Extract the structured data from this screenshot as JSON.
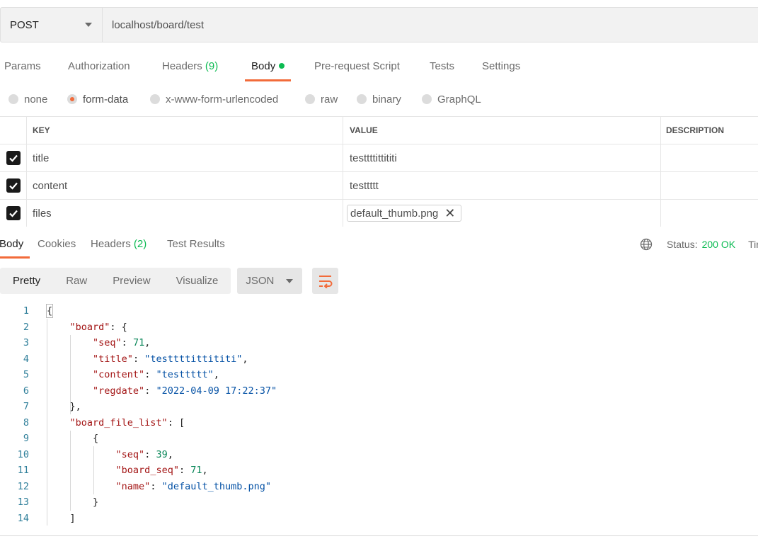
{
  "request": {
    "method": "POST",
    "url": "localhost/board/test"
  },
  "request_tabs": [
    {
      "label": "Params"
    },
    {
      "label": "Authorization"
    },
    {
      "label": "Headers",
      "count": "(9)"
    },
    {
      "label": "Body",
      "active": true
    },
    {
      "label": "Pre-request Script"
    },
    {
      "label": "Tests"
    },
    {
      "label": "Settings"
    }
  ],
  "body_types": [
    "none",
    "form-data",
    "x-www-form-urlencoded",
    "raw",
    "binary",
    "GraphQL"
  ],
  "body_type_selected": "form-data",
  "params_table": {
    "headers": [
      "KEY",
      "VALUE",
      "DESCRIPTION"
    ],
    "rows": [
      {
        "checked": true,
        "key": "title",
        "value": "testtttittititi",
        "description": ""
      },
      {
        "checked": true,
        "key": "content",
        "value": "testtttt",
        "description": ""
      },
      {
        "checked": true,
        "key": "files",
        "value": "default_thumb.png",
        "is_file": true,
        "description": ""
      }
    ]
  },
  "response_tabs": [
    {
      "label": "Body",
      "active": true
    },
    {
      "label": "Cookies"
    },
    {
      "label": "Headers",
      "count": "(2)"
    },
    {
      "label": "Test Results"
    }
  ],
  "status": {
    "label": "Status:",
    "value": "200 OK",
    "time_partial": "Tir"
  },
  "view_modes": [
    "Pretty",
    "Raw",
    "Preview",
    "Visualize"
  ],
  "view_mode_selected": "Pretty",
  "format": "JSON",
  "code_lines": [
    {
      "n": "1",
      "text": "{"
    },
    {
      "n": "2",
      "text": "    \"board\": {"
    },
    {
      "n": "3",
      "text": "        \"seq\": 71,"
    },
    {
      "n": "4",
      "text": "        \"title\": \"testtttittititi\","
    },
    {
      "n": "5",
      "text": "        \"content\": \"testtttt\","
    },
    {
      "n": "6",
      "text": "        \"regdate\": \"2022-04-09 17:22:37\""
    },
    {
      "n": "7",
      "text": "    },"
    },
    {
      "n": "8",
      "text": "    \"board_file_list\": ["
    },
    {
      "n": "9",
      "text": "        {"
    },
    {
      "n": "10",
      "text": "            \"seq\": 39,"
    },
    {
      "n": "11",
      "text": "            \"board_seq\": 71,"
    },
    {
      "n": "12",
      "text": "            \"name\": \"default_thumb.png\""
    },
    {
      "n": "13",
      "text": "        }"
    },
    {
      "n": "14",
      "text": "    ]"
    }
  ],
  "colors": {
    "accent": "#f26b3a",
    "success": "#0cbb52",
    "json_key": "#a31515",
    "json_string": "#0451a5",
    "json_number": "#098658"
  }
}
